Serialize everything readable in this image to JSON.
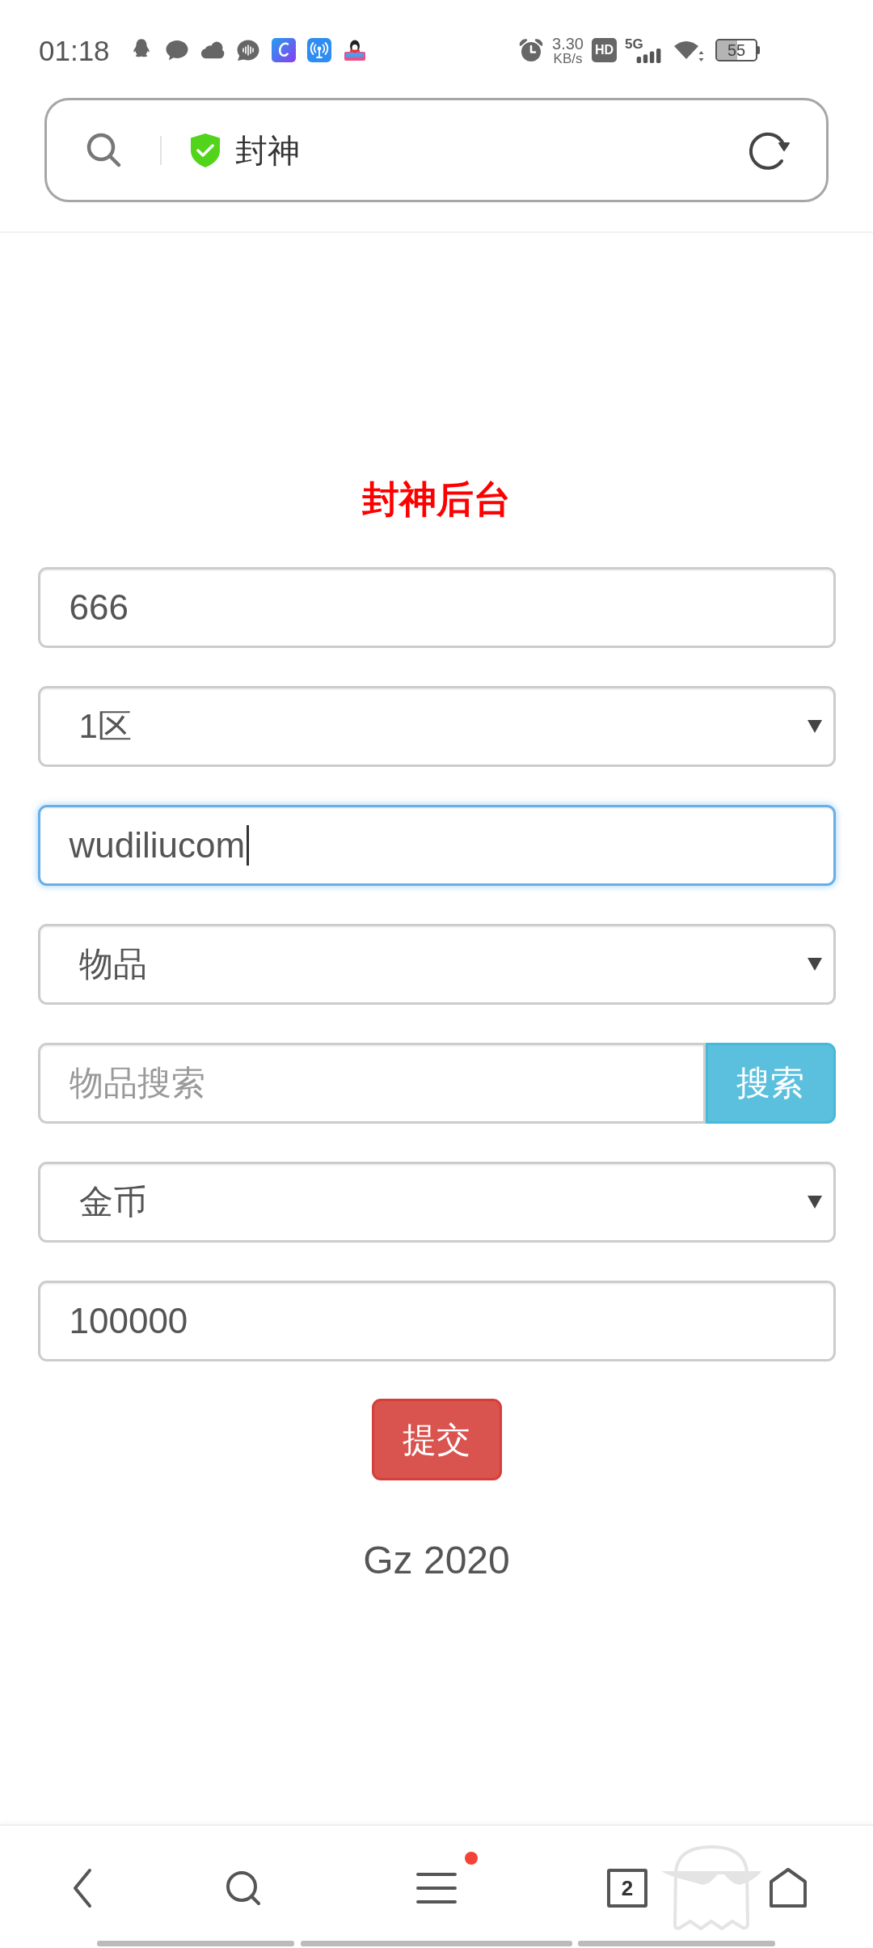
{
  "status_bar": {
    "time": "01:18",
    "network_speed": "3.30",
    "network_speed_unit": "KB/s",
    "hd_badge": "HD",
    "network_type": "5G",
    "battery": "55"
  },
  "address_bar": {
    "title": "封神"
  },
  "form": {
    "title": "封神后台",
    "fields": [
      {
        "kind": "input",
        "value": "666",
        "focused": false
      },
      {
        "kind": "select",
        "value": "1区",
        "focused": false
      },
      {
        "kind": "input",
        "value": "wudiliucom",
        "focused": true
      },
      {
        "kind": "select",
        "value": "物品",
        "focused": false
      },
      {
        "kind": "search",
        "placeholder": "物品搜索",
        "button": "搜索",
        "focused": false
      },
      {
        "kind": "select",
        "value": "金币",
        "focused": false
      },
      {
        "kind": "input",
        "value": "100000",
        "focused": false
      }
    ],
    "submit": "提交"
  },
  "footer": {
    "text": "Gz 2020"
  },
  "bottom_nav": {
    "tab_count": "2",
    "menu_badge": true
  }
}
